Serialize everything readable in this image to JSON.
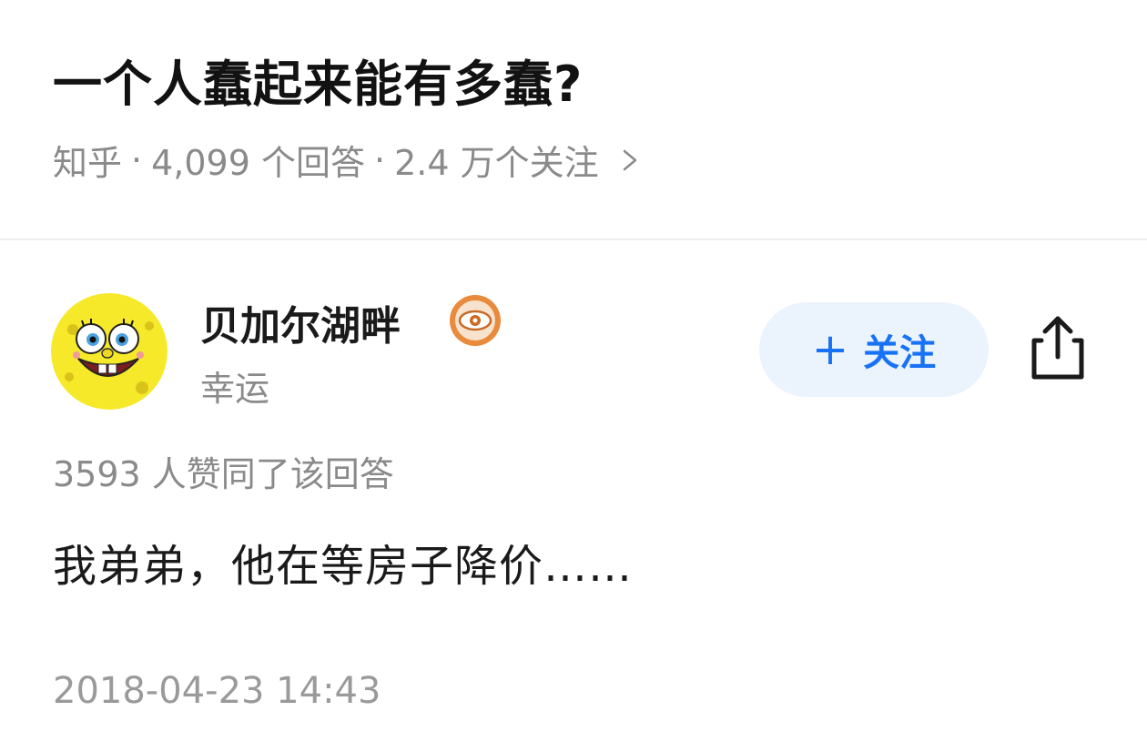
{
  "question": {
    "title": "一个人蠢起来能有多蠢?",
    "source": "知乎",
    "answer_count": "4,099 个回答",
    "follower_count": "2.4 万个关注",
    "separator": "·"
  },
  "author": {
    "name": "贝加尔湖畔",
    "headline": "幸运",
    "avatar_icon": "spongebob-avatar",
    "badge_icon": "eye-badge-icon",
    "follow_plus": "+",
    "follow_label": "关注"
  },
  "answer": {
    "vote_text": "3593 人赞同了该回答",
    "content": "我弟弟，他在等房子降价……",
    "date": "2018-04-23 14:43"
  },
  "colors": {
    "accent": "#1772f6",
    "follow_bg": "#ebf4fd",
    "meta_gray": "#8a8a8a",
    "badge_orange": "#e98a3c"
  }
}
